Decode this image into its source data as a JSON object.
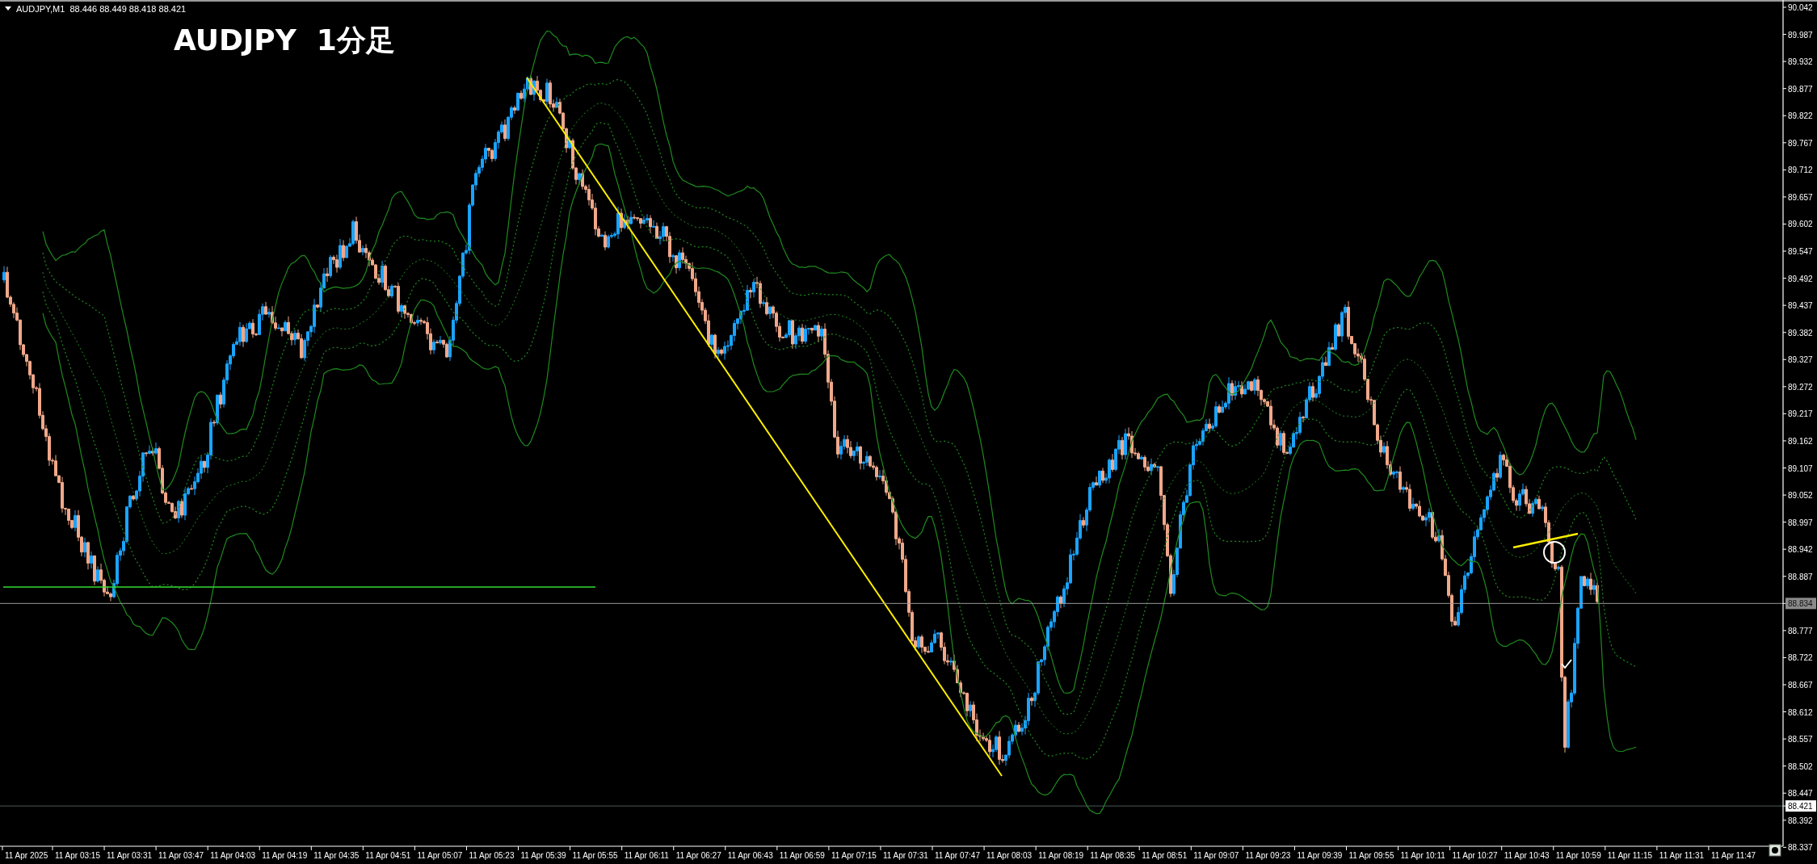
{
  "header": {
    "symbol": "AUDJPY,M1",
    "ohlc": "88.446 88.449 88.418 88.421"
  },
  "title": "AUDJPY  1分足",
  "price_axis": {
    "labels": [
      {
        "text": "90.042",
        "kind": "tick"
      },
      {
        "text": "89.987",
        "kind": "tick"
      },
      {
        "text": "89.932",
        "kind": "tick"
      },
      {
        "text": "89.877",
        "kind": "tick"
      },
      {
        "text": "89.822",
        "kind": "tick"
      },
      {
        "text": "89.767",
        "kind": "tick"
      },
      {
        "text": "89.712",
        "kind": "tick"
      },
      {
        "text": "89.657",
        "kind": "tick"
      },
      {
        "text": "89.602",
        "kind": "tick"
      },
      {
        "text": "89.547",
        "kind": "tick"
      },
      {
        "text": "89.492",
        "kind": "tick"
      },
      {
        "text": "89.437",
        "kind": "tick"
      },
      {
        "text": "89.382",
        "kind": "tick"
      },
      {
        "text": "89.327",
        "kind": "tick"
      },
      {
        "text": "89.272",
        "kind": "tick"
      },
      {
        "text": "89.217",
        "kind": "tick"
      },
      {
        "text": "89.162",
        "kind": "tick"
      },
      {
        "text": "89.107",
        "kind": "tick"
      },
      {
        "text": "89.052",
        "kind": "tick"
      },
      {
        "text": "88.997",
        "kind": "tick"
      },
      {
        "text": "88.942",
        "kind": "tick"
      },
      {
        "text": "88.887",
        "kind": "tick"
      },
      {
        "text": "88.834",
        "kind": "bid-line"
      },
      {
        "text": "88.777",
        "kind": "tick"
      },
      {
        "text": "88.722",
        "kind": "tick"
      },
      {
        "text": "88.667",
        "kind": "tick"
      },
      {
        "text": "88.612",
        "kind": "tick"
      },
      {
        "text": "88.557",
        "kind": "tick"
      },
      {
        "text": "88.502",
        "kind": "tick"
      },
      {
        "text": "88.447",
        "kind": "tick"
      },
      {
        "text": "88.421",
        "kind": "last-price"
      },
      {
        "text": "88.392",
        "kind": "tick"
      },
      {
        "text": "88.337",
        "kind": "tick"
      }
    ]
  },
  "time_axis": {
    "labels": [
      "11 Apr 2025",
      "11 Apr 03:15",
      "11 Apr 03:31",
      "11 Apr 03:47",
      "11 Apr 04:03",
      "11 Apr 04:19",
      "11 Apr 04:35",
      "11 Apr 04:51",
      "11 Apr 05:07",
      "11 Apr 05:23",
      "11 Apr 05:39",
      "11 Apr 05:55",
      "11 Apr 06:11",
      "11 Apr 06:27",
      "11 Apr 06:43",
      "11 Apr 06:59",
      "11 Apr 07:15",
      "11 Apr 07:31",
      "11 Apr 07:47",
      "11 Apr 08:03",
      "11 Apr 08:19",
      "11 Apr 08:35",
      "11 Apr 08:51",
      "11 Apr 09:07",
      "11 Apr 09:23",
      "11 Apr 09:39",
      "11 Apr 09:55",
      "11 Apr 10:11",
      "11 Apr 10:27",
      "11 Apr 10:43",
      "11 Apr 10:59",
      "11 Apr 11:15",
      "11 Apr 11:31",
      "11 Apr 11:47"
    ]
  }
}
